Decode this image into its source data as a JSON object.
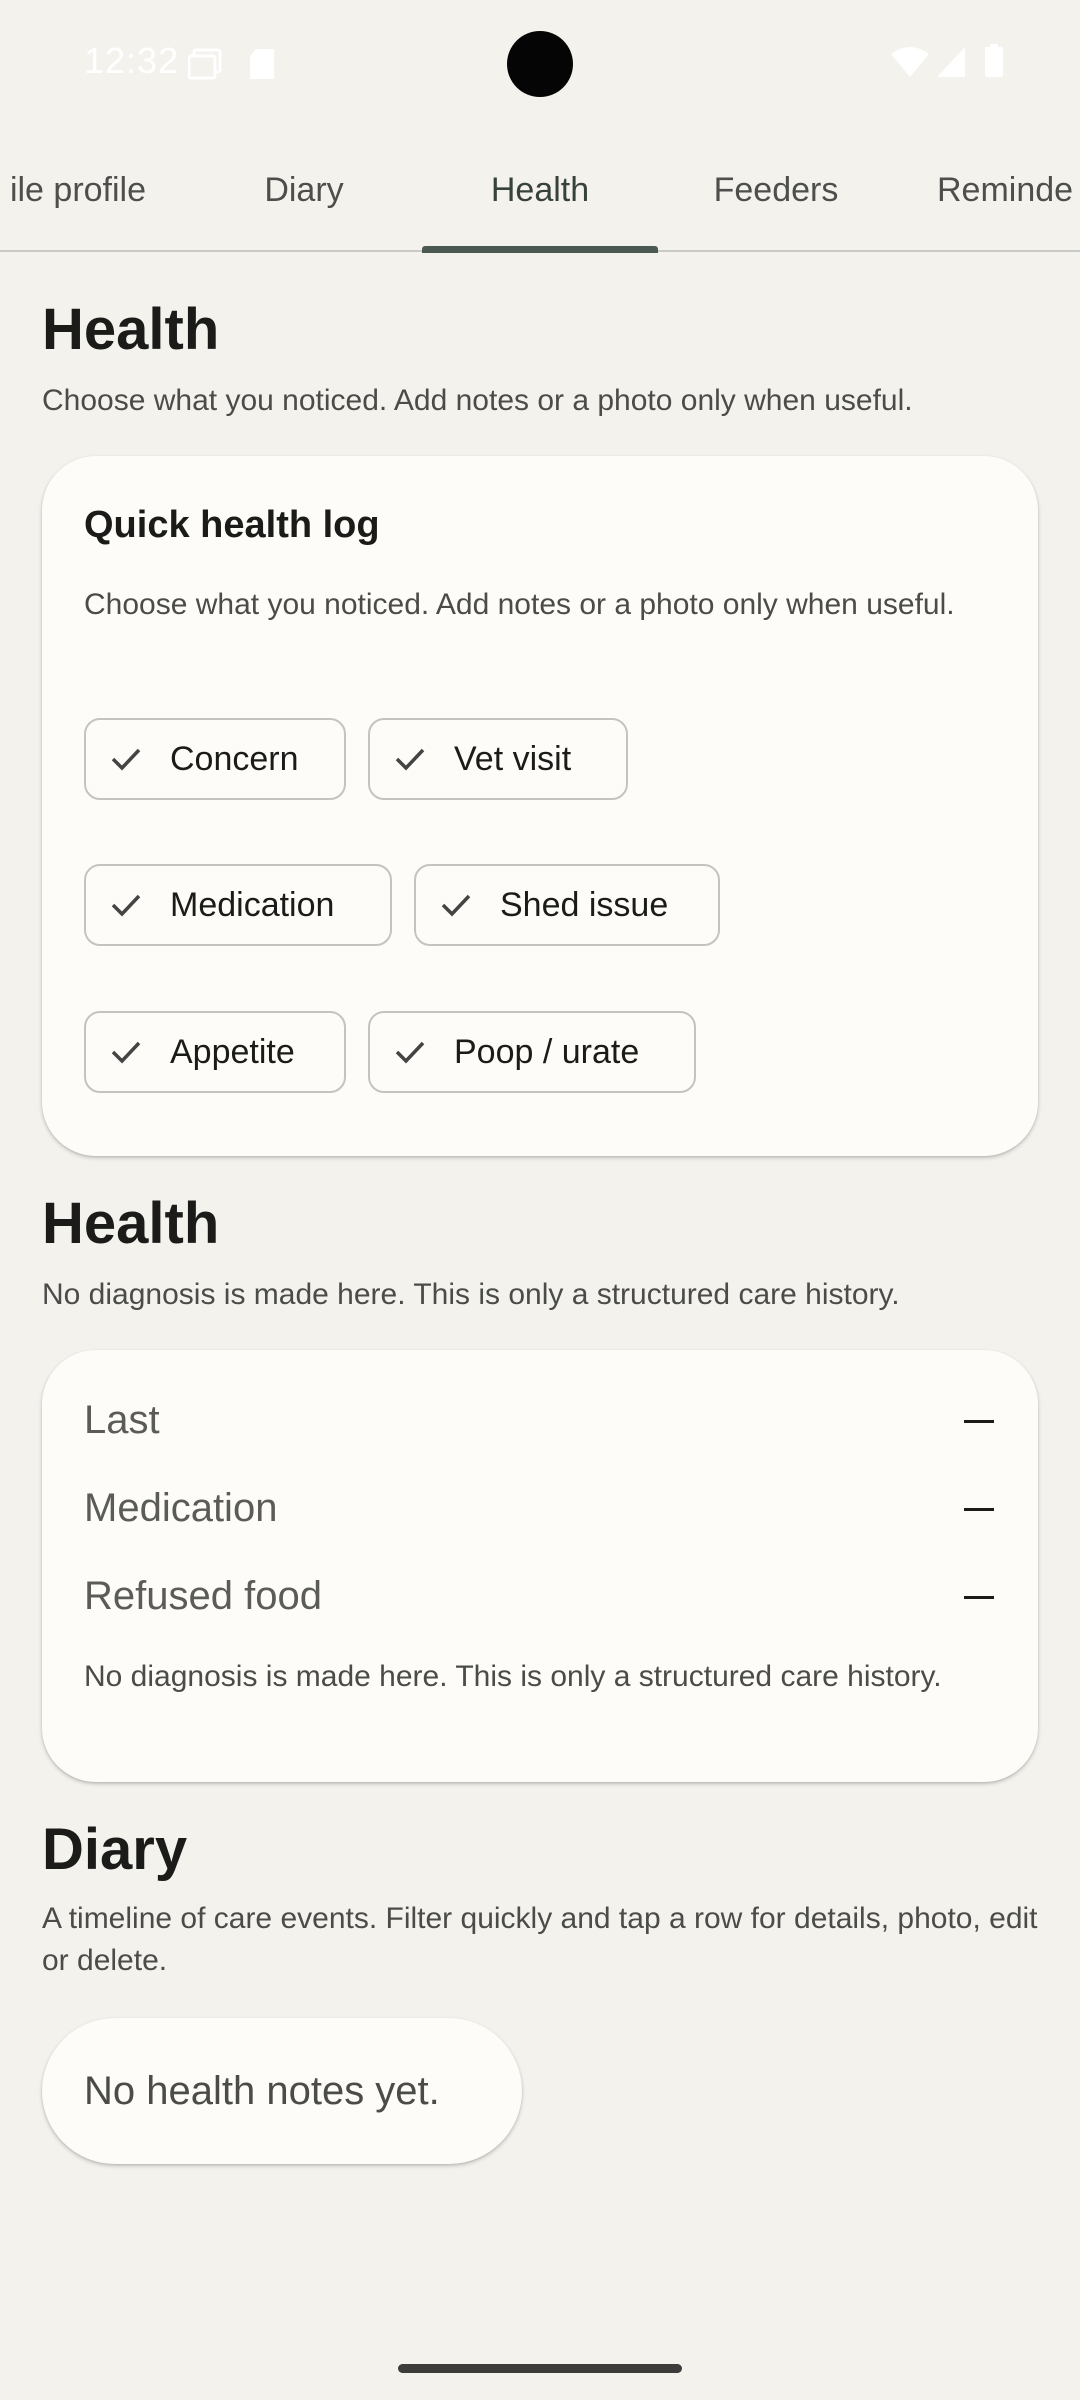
{
  "status_bar": {
    "time": "12:32",
    "icons": [
      "screen-record-icon",
      "sd-card-icon",
      "wifi-icon",
      "signal-icon",
      "battery-icon"
    ]
  },
  "tabs": [
    {
      "label": "ile profile",
      "active": false
    },
    {
      "label": "Diary",
      "active": false
    },
    {
      "label": "Health",
      "active": true
    },
    {
      "label": "Feeders",
      "active": false
    },
    {
      "label": "Reminde",
      "active": false
    }
  ],
  "health_section": {
    "title": "Health",
    "subtitle": "Choose what you noticed. Add notes or a photo only when useful."
  },
  "quick_log": {
    "title": "Quick health log",
    "subtitle": "Choose what you noticed. Add notes or a photo only when useful.",
    "chips": [
      "Concern",
      "Vet visit",
      "Medication",
      "Shed issue",
      "Appetite",
      "Poop / urate"
    ]
  },
  "summary_section": {
    "title": "Health",
    "subtitle": "No diagnosis is made here. This is only a structured care history."
  },
  "summary_card": {
    "rows": [
      {
        "label": "Last",
        "value": "—"
      },
      {
        "label": "Medication",
        "value": "—"
      },
      {
        "label": "Refused food",
        "value": "—"
      }
    ],
    "footnote": "No diagnosis is made here. This is only a structured care history."
  },
  "diary_section": {
    "title": "Diary",
    "subtitle": "A timeline of care events. Filter quickly and tap a row for details, photo, edit or delete."
  },
  "empty_state": "No health notes yet.",
  "colors": {
    "background": "#f4f2ed",
    "card": "#fdfcf8",
    "tab_indicator": "#4a5a53"
  }
}
